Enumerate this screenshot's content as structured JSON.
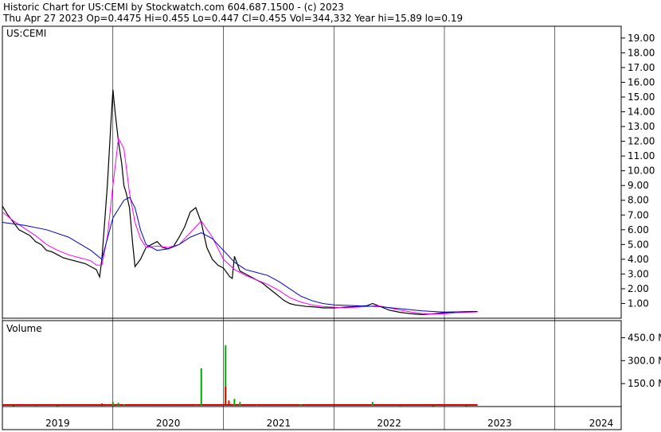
{
  "header": {
    "line1": "Historic Chart for US:CEMI by Stockwatch.com 604.687.1500 - (c) 2023",
    "line2": "Thu Apr 27 2023   Op=0.4475   Hi=0.455   Lo=0.447   Cl=0.455   Vol=344,332   Year hi=15.89   lo=0.19"
  },
  "colors": {
    "price": "#000000",
    "ma_short": "#ff00ff",
    "ma_long": "#0000cc",
    "volume": "#00aa00",
    "volume_red": "#dd0000",
    "grid": "#000000"
  },
  "chart_data": [
    {
      "type": "line",
      "panel": "price",
      "label": "US:CEMI",
      "y_ticks": [
        "19.00",
        "18.00",
        "17.00",
        "16.00",
        "15.00",
        "14.00",
        "13.00",
        "12.00",
        "11.00",
        "10.00",
        "9.00",
        "8.00",
        "7.00",
        "6.00",
        "5.00",
        "4.00",
        "3.00",
        "2.00",
        "1.00"
      ],
      "ylim": [
        0,
        19.8
      ],
      "xlim": [
        2019.0,
        2024.6
      ],
      "series": [
        {
          "style": "price",
          "x": [
            2019.0,
            2019.05,
            2019.1,
            2019.15,
            2019.2,
            2019.25,
            2019.3,
            2019.35,
            2019.4,
            2019.45,
            2019.5,
            2019.55,
            2019.6,
            2019.65,
            2019.7,
            2019.75,
            2019.8,
            2019.85,
            2019.88,
            2019.9,
            2019.92,
            2019.95,
            2019.98,
            2020.0,
            2020.02,
            2020.05,
            2020.08,
            2020.1,
            2020.12,
            2020.15,
            2020.18,
            2020.2,
            2020.25,
            2020.3,
            2020.35,
            2020.4,
            2020.45,
            2020.5,
            2020.55,
            2020.6,
            2020.65,
            2020.7,
            2020.75,
            2020.8,
            2020.85,
            2020.9,
            2020.95,
            2021.0,
            2021.02,
            2021.04,
            2021.06,
            2021.08,
            2021.1,
            2021.15,
            2021.2,
            2021.25,
            2021.3,
            2021.35,
            2021.4,
            2021.45,
            2021.5,
            2021.55,
            2021.6,
            2021.65,
            2021.7,
            2021.75,
            2021.8,
            2021.85,
            2021.9,
            2021.95,
            2022.0,
            2022.1,
            2022.2,
            2022.3,
            2022.35,
            2022.4,
            2022.45,
            2022.5,
            2022.6,
            2022.7,
            2022.8,
            2022.9,
            2023.0,
            2023.1,
            2023.2,
            2023.3
          ],
          "y": [
            7.6,
            7.0,
            6.5,
            6.0,
            5.8,
            5.6,
            5.2,
            5.0,
            4.6,
            4.5,
            4.3,
            4.1,
            4.0,
            3.9,
            3.8,
            3.7,
            3.5,
            3.3,
            2.8,
            4.0,
            6.0,
            9.0,
            13.0,
            15.5,
            14.0,
            12.0,
            10.5,
            9.0,
            8.5,
            7.5,
            5.0,
            3.5,
            4.0,
            4.8,
            5.0,
            5.2,
            4.8,
            4.7,
            4.9,
            5.5,
            6.2,
            7.2,
            7.5,
            6.5,
            4.8,
            4.0,
            3.6,
            3.4,
            3.2,
            3.0,
            2.8,
            2.7,
            4.2,
            3.2,
            3.0,
            2.8,
            2.6,
            2.4,
            2.1,
            1.8,
            1.5,
            1.2,
            1.0,
            0.9,
            0.85,
            0.8,
            0.78,
            0.75,
            0.7,
            0.7,
            0.7,
            0.75,
            0.8,
            0.85,
            1.0,
            0.85,
            0.7,
            0.55,
            0.4,
            0.3,
            0.25,
            0.3,
            0.38,
            0.42,
            0.44,
            0.455
          ]
        },
        {
          "style": "ma_short",
          "x": [
            2019.0,
            2019.1,
            2019.2,
            2019.3,
            2019.4,
            2019.5,
            2019.6,
            2019.7,
            2019.8,
            2019.85,
            2019.9,
            2019.95,
            2020.0,
            2020.05,
            2020.1,
            2020.15,
            2020.2,
            2020.25,
            2020.3,
            2020.4,
            2020.5,
            2020.6,
            2020.7,
            2020.8,
            2020.9,
            2021.0,
            2021.1,
            2021.2,
            2021.3,
            2021.4,
            2021.5,
            2021.6,
            2021.7,
            2021.8,
            2021.9,
            2022.0,
            2022.1,
            2022.2,
            2022.3,
            2022.4,
            2022.5,
            2022.6,
            2022.7,
            2022.8,
            2022.9,
            2023.0,
            2023.1,
            2023.2,
            2023.3
          ],
          "y": [
            7.2,
            6.6,
            6.1,
            5.6,
            5.0,
            4.6,
            4.3,
            4.1,
            3.9,
            3.6,
            3.6,
            5.5,
            9.0,
            12.2,
            11.5,
            8.5,
            6.5,
            5.4,
            4.8,
            4.9,
            4.8,
            5.0,
            5.8,
            6.6,
            5.5,
            4.0,
            3.3,
            2.9,
            2.6,
            2.3,
            1.9,
            1.4,
            1.1,
            0.9,
            0.8,
            0.75,
            0.7,
            0.75,
            0.8,
            0.85,
            0.7,
            0.55,
            0.42,
            0.32,
            0.28,
            0.3,
            0.36,
            0.4,
            0.43
          ]
        },
        {
          "style": "ma_long",
          "x": [
            2019.0,
            2019.2,
            2019.4,
            2019.6,
            2019.8,
            2019.9,
            2020.0,
            2020.1,
            2020.15,
            2020.2,
            2020.25,
            2020.3,
            2020.4,
            2020.5,
            2020.6,
            2020.7,
            2020.8,
            2020.9,
            2021.0,
            2021.1,
            2021.2,
            2021.3,
            2021.4,
            2021.5,
            2021.6,
            2021.7,
            2021.8,
            2021.9,
            2022.0,
            2022.2,
            2022.4,
            2022.6,
            2022.8,
            2023.0,
            2023.2,
            2023.3
          ],
          "y": [
            6.5,
            6.3,
            6.0,
            5.5,
            4.6,
            4.0,
            6.8,
            8.0,
            8.2,
            7.5,
            6.0,
            5.0,
            4.6,
            4.7,
            5.0,
            5.5,
            5.8,
            5.4,
            4.6,
            3.8,
            3.3,
            3.1,
            2.9,
            2.5,
            2.0,
            1.5,
            1.2,
            1.0,
            0.9,
            0.85,
            0.8,
            0.65,
            0.5,
            0.42,
            0.45,
            0.46
          ]
        }
      ]
    },
    {
      "type": "bar",
      "panel": "volume",
      "label": "Volume",
      "y_ticks": [
        "450.0 M",
        "300.0 M",
        "150.0 M"
      ],
      "ylim": [
        0,
        520
      ],
      "x_ticks": [
        "2019",
        "2020",
        "2021",
        "2022",
        "2023",
        "2024"
      ],
      "x": [
        2019.1,
        2019.3,
        2019.5,
        2019.7,
        2019.9,
        2019.95,
        2020.0,
        2020.05,
        2020.1,
        2020.3,
        2020.5,
        2020.75,
        2020.8,
        2021.0,
        2021.02,
        2021.05,
        2021.1,
        2021.15,
        2021.3,
        2021.5,
        2021.7,
        2022.0,
        2022.35,
        2022.6,
        2022.9,
        2023.2
      ],
      "values": [
        3,
        4,
        3,
        5,
        4,
        8,
        30,
        25,
        15,
        6,
        5,
        8,
        250,
        6,
        400,
        20,
        50,
        30,
        10,
        6,
        15,
        5,
        30,
        4,
        3,
        3
      ],
      "red_x": [
        2019.9,
        2021.02,
        2021.05
      ],
      "red_values": [
        20,
        130,
        40
      ]
    }
  ]
}
